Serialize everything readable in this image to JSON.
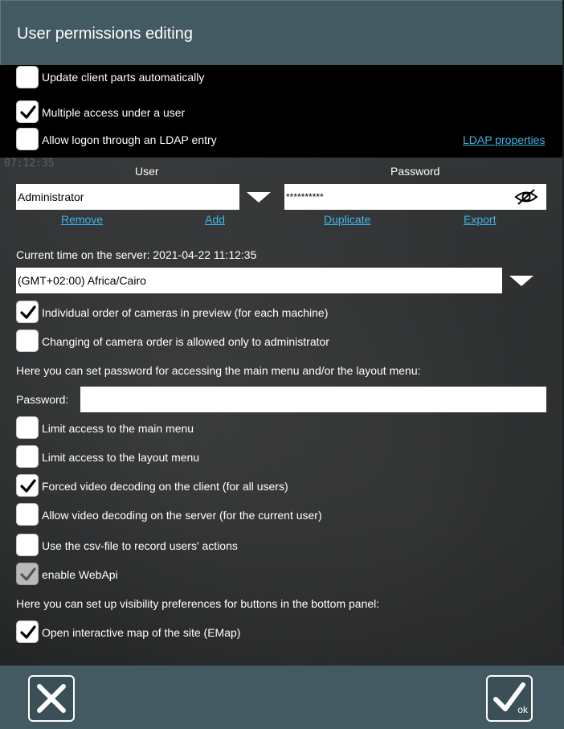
{
  "dialog": {
    "title": "User permissions editing"
  },
  "options_top": [
    {
      "label": "Update client parts automatically",
      "checked": false
    },
    {
      "label": "Multiple access under a user",
      "checked": true
    },
    {
      "label": "Allow logon through an LDAP entry",
      "checked": false
    }
  ],
  "ldap_link": "LDAP properties",
  "overlay_timestamp": "07:12:35",
  "credentials": {
    "user_label": "User",
    "password_label": "Password",
    "user_value": "Administrator",
    "password_value": "**********",
    "actions": [
      "Remove",
      "Add",
      "Duplicate",
      "Export"
    ]
  },
  "server_time": {
    "text": "Current time on the server: 2021-04-22 11:12:35",
    "timezone": "(GMT+02:00) Africa/Cairo"
  },
  "options_mid": [
    {
      "label": "Individual order of cameras in preview (for each machine)",
      "checked": true
    },
    {
      "label": "Changing of camera order is allowed only to administrator",
      "checked": false
    }
  ],
  "menu_password": {
    "hint": "Here you can set password for accessing the main menu and/or the layout menu:",
    "label": "Password:",
    "value": ""
  },
  "options_bottom": [
    {
      "label": "Limit access to the main menu",
      "checked": false
    },
    {
      "label": "Limit access to the layout menu",
      "checked": false
    },
    {
      "label": "Forced video decoding on the client (for all users)",
      "checked": true
    },
    {
      "label": "Allow video decoding on the server (for the current user)",
      "checked": false
    },
    {
      "label": "Use the csv-file to record users' actions",
      "checked": false
    },
    {
      "label": "enable WebApi",
      "checked": true,
      "disabled": true
    }
  ],
  "visibility": {
    "hint": "Here you can set up visibility preferences for buttons in the bottom panel:",
    "options": [
      {
        "label": "Open interactive map of the site (EMap)",
        "checked": true
      }
    ]
  },
  "footer": {
    "ok_label": "ok"
  },
  "colors": {
    "header_bg": "#435a62",
    "link": "#3fb5ea",
    "background": "#2a2d2f"
  }
}
